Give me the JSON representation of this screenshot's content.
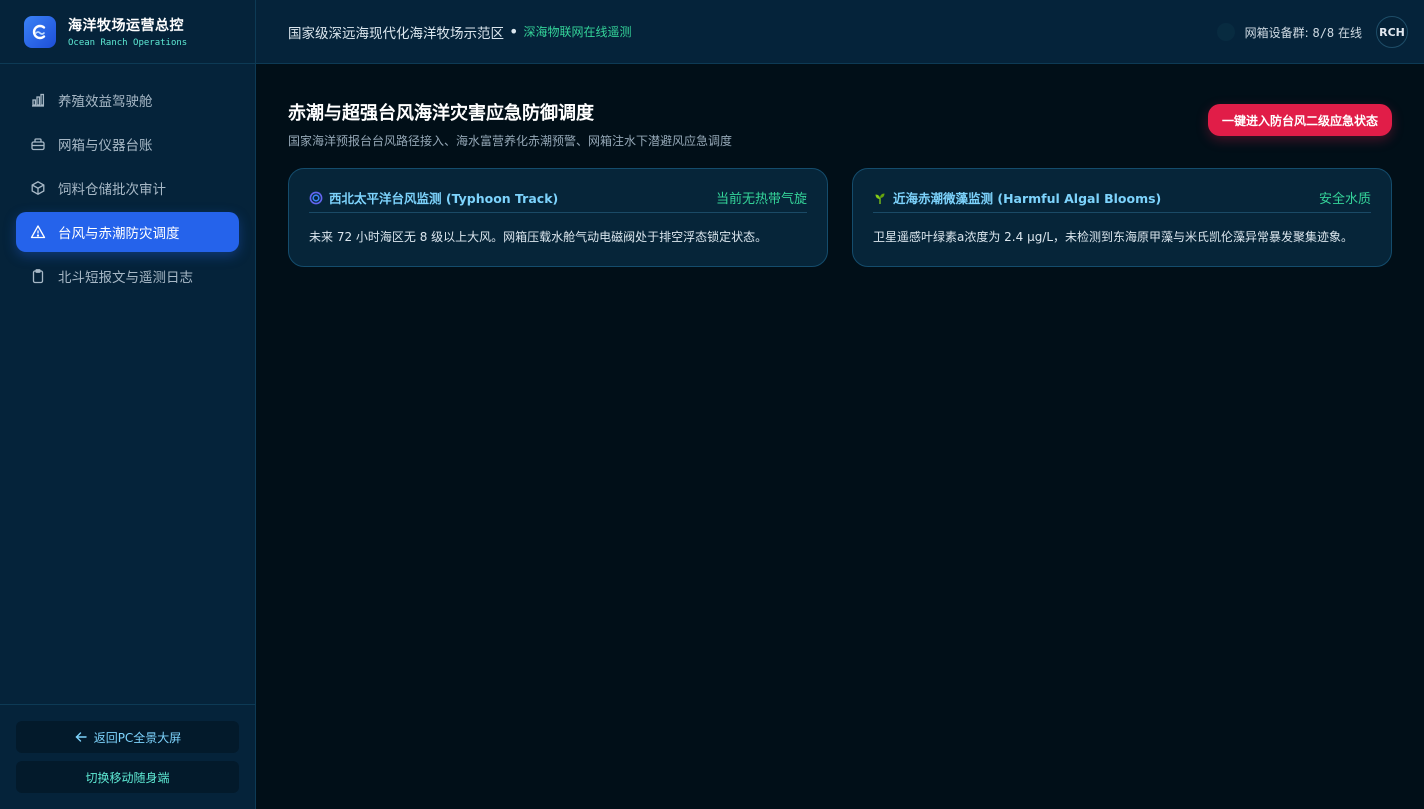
{
  "brand": {
    "title": "海洋牧场运营总控",
    "subtitle": "Ocean Ranch Operations"
  },
  "nav": {
    "items": [
      {
        "label": "养殖效益驾驶舱",
        "icon": "bar-chart-icon",
        "active": false
      },
      {
        "label": "网箱与仪器台账",
        "icon": "briefcase-icon",
        "active": false
      },
      {
        "label": "饲料仓储批次审计",
        "icon": "package-icon",
        "active": false
      },
      {
        "label": "台风与赤潮防灾调度",
        "icon": "alert-triangle-icon",
        "active": true
      },
      {
        "label": "北斗短报文与遥测日志",
        "icon": "clipboard-icon",
        "active": false
      }
    ]
  },
  "sidebar_bottom": {
    "back_label": "返回PC全景大屏",
    "mobile_label": "切换移动随身端"
  },
  "header": {
    "title": "国家级深远海现代化海洋牧场示范区",
    "separator": "•",
    "subtitle": "深海物联网在线遥测",
    "status_label": "网箱设备群:",
    "status_count": "8/8",
    "status_suffix": "在线",
    "avatar": "RCH"
  },
  "main": {
    "title": "赤潮与超强台风海洋灾害应急防御调度",
    "subtitle": "国家海洋预报台台风路径接入、海水富营养化赤潮预警、网箱注水下潜避风应急调度",
    "emergency_button": "一键进入防台风二级应急状态",
    "cards": [
      {
        "title": "西北太平洋台风监测 (Typhoon Track)",
        "status": "当前无热带气旋",
        "body": "未来 72 小时海区无 8 级以上大风。网箱压载水舱气动电磁阀处于排空浮态锁定状态。",
        "icon": "cyclone-icon"
      },
      {
        "title": "近海赤潮微藻监测 (Harmful Algal Blooms)",
        "status": "安全水质",
        "body": "卫星遥感叶绿素a浓度为 2.4 μg/L，未检测到东海原甲藻与米氏凯伦藻异常暴发聚集迹象。",
        "icon": "seedling-icon"
      }
    ]
  },
  "colors": {
    "accent": "#2563eb",
    "danger": "#e11d48",
    "ok": "#34d399",
    "sidebar_bg": "#05233a",
    "page_bg": "#010f18"
  }
}
